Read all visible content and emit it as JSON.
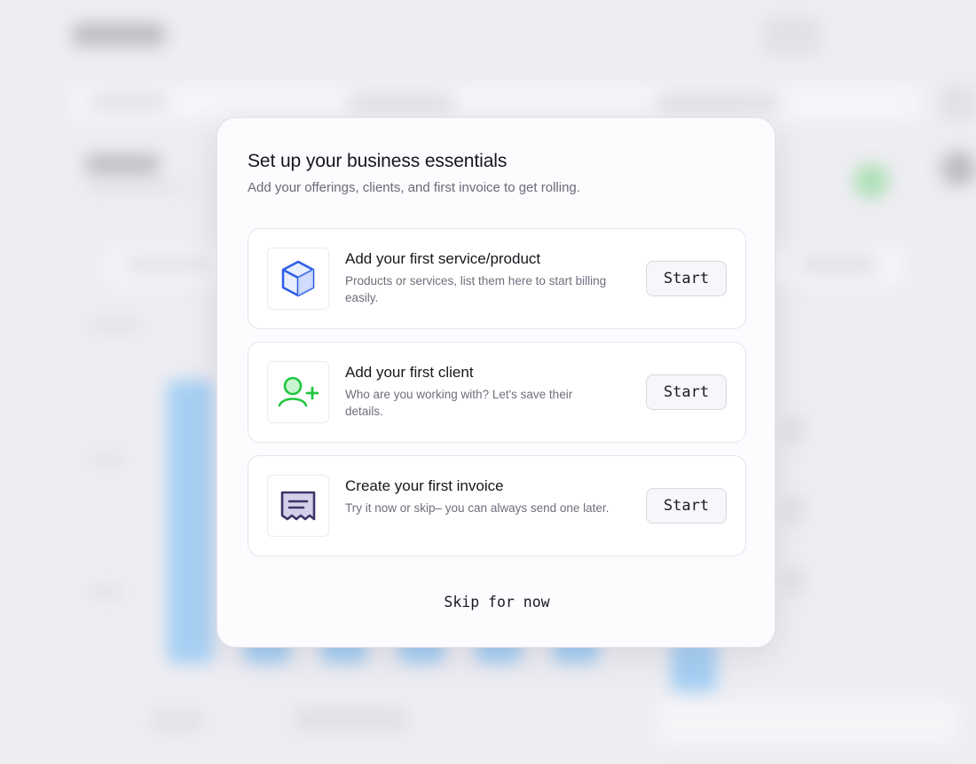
{
  "modal": {
    "title": "Set up your business essentials",
    "subtitle": "Add your offerings, clients, and first invoice to get rolling.",
    "tasks": [
      {
        "title": "Add your first service/product",
        "description": "Products or services, list them here to start billing easily.",
        "button_label": "Start",
        "icon": "cube-icon",
        "icon_color": "#2f5fe8"
      },
      {
        "title": "Add your first client",
        "description": "Who are you working with? Let's save their details.",
        "button_label": "Start",
        "icon": "add-user-icon",
        "icon_color": "#1fc63e"
      },
      {
        "title": "Create your first invoice",
        "description": "Try it now or skip– you can always send one later.",
        "button_label": "Start",
        "icon": "invoice-icon",
        "icon_color": "#3c3566"
      }
    ],
    "skip_label": "Skip for now"
  },
  "colors": {
    "overlay_background": "#eeedf2",
    "modal_background": "#fcfbfe",
    "chart_bar": "#9fcdf4"
  }
}
